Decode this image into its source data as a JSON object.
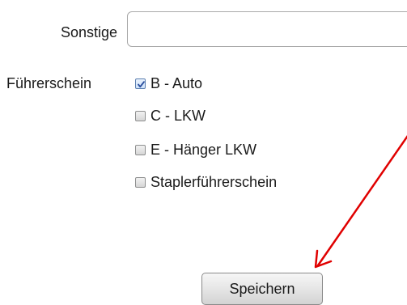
{
  "form": {
    "sonstige": {
      "label": "Sonstige",
      "value": "",
      "placeholder": ""
    },
    "fuehrerschein": {
      "label": "Führerschein",
      "options": [
        {
          "label": "B - Auto",
          "checked": true
        },
        {
          "label": "C - LKW",
          "checked": false
        },
        {
          "label": "E - Hänger LKW",
          "checked": false
        },
        {
          "label": "Staplerführerschein",
          "checked": false
        }
      ]
    },
    "save_button": {
      "label": "Speichern"
    }
  },
  "annotation": {
    "arrow_color": "#e00000"
  },
  "colors": {
    "checkmark": "#2b4f9e"
  }
}
